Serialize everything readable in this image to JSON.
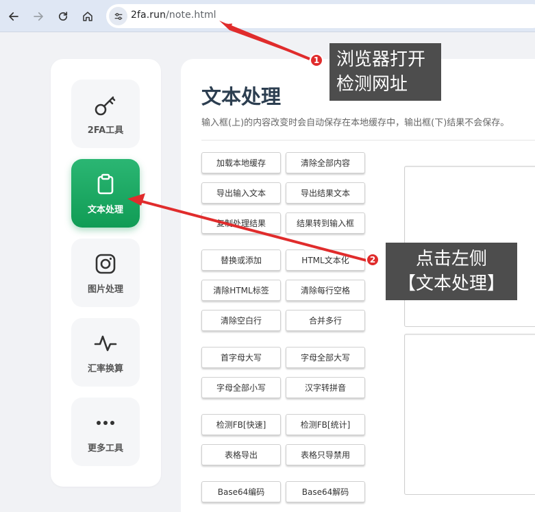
{
  "browser": {
    "url_host": "2fa.run",
    "url_path": "/note.html"
  },
  "sidebar": {
    "items": [
      {
        "label": "2FA工具",
        "icon": "key-icon",
        "active": false
      },
      {
        "label": "文本处理",
        "icon": "clipboard-icon",
        "active": true
      },
      {
        "label": "图片处理",
        "icon": "instagram-icon",
        "active": false
      },
      {
        "label": "汇率换算",
        "icon": "pulse-icon",
        "active": false
      },
      {
        "label": "更多工具",
        "icon": "more-dots-icon",
        "active": false
      }
    ]
  },
  "main": {
    "title": "文本处理",
    "description": "输入框(上)的内容改变时会自动保存在本地缓存中，输出框(下)结果不会保存。",
    "buttons": [
      "加载本地缓存",
      "清除全部内容",
      "导出输入文本",
      "导出结果文本",
      "复制处理结果",
      "结果转到输入框",
      "替换或添加",
      "HTML文本化",
      "清除HTML标签",
      "清除每行空格",
      "清除空白行",
      "合并多行",
      "首字母大写",
      "字母全部大写",
      "字母全部小写",
      "汉字转拼音",
      "检测FB[快速]",
      "检测FB[统计]",
      "表格导出",
      "表格只导禁用",
      "Base64编码",
      "Base64解码"
    ]
  },
  "annotations": {
    "callout1": {
      "badge": "1",
      "line1": "浏览器打开",
      "line2": "检测网址"
    },
    "callout2": {
      "badge": "2",
      "line1": "点击左侧",
      "line2": "【文本处理】"
    },
    "color": "#e02c2c"
  },
  "colors": {
    "accent": "#109c55",
    "topbar": "#dfe7f4",
    "background": "#f1f2f5"
  }
}
